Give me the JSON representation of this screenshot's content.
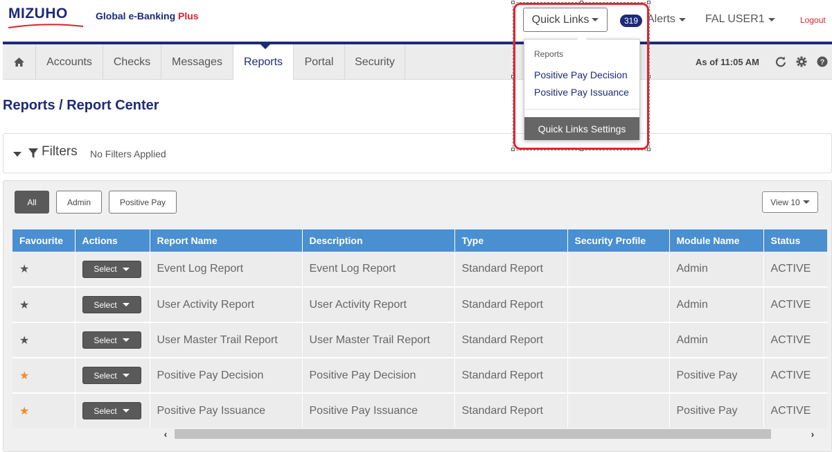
{
  "brand": {
    "logo": "MIZUHO",
    "product_main": "Global e-Banking",
    "product_plus": "Plus"
  },
  "header": {
    "quick_links": "Quick Links",
    "alerts_count": "319",
    "alerts": "Alerts",
    "user": "FAL USER1",
    "logout": "Logout"
  },
  "nav": {
    "items": [
      "Accounts",
      "Checks",
      "Messages",
      "Reports",
      "Portal",
      "Security"
    ],
    "active": "Reports",
    "as_of": "As of 11:05 AM"
  },
  "page": {
    "title": "Reports / Report Center"
  },
  "filters": {
    "title": "Filters",
    "status": "No Filters Applied"
  },
  "toolbar": {
    "chips": [
      "All",
      "Admin",
      "Positive Pay"
    ],
    "active_chip": "All",
    "view": "View 10"
  },
  "table": {
    "columns": [
      "Favourite",
      "Actions",
      "Report Name",
      "Description",
      "Type",
      "Security Profile",
      "Module Name",
      "Status"
    ],
    "rows": [
      {
        "favourite": false,
        "action": "Select",
        "name": "Event Log Report",
        "description": "Event Log Report",
        "type": "Standard Report",
        "security_profile": "",
        "module": "Admin",
        "status": "ACTIVE"
      },
      {
        "favourite": false,
        "action": "Select",
        "name": "User Activity Report",
        "description": "User Activity Report",
        "type": "Standard Report",
        "security_profile": "",
        "module": "Admin",
        "status": "ACTIVE"
      },
      {
        "favourite": false,
        "action": "Select",
        "name": "User Master Trail Report",
        "description": "User Master Trail Report",
        "type": "Standard Report",
        "security_profile": "",
        "module": "Admin",
        "status": "ACTIVE"
      },
      {
        "favourite": true,
        "action": "Select",
        "name": "Positive Pay Decision",
        "description": "Positive Pay Decision",
        "type": "Standard Report",
        "security_profile": "",
        "module": "Positive Pay",
        "status": "ACTIVE"
      },
      {
        "favourite": true,
        "action": "Select",
        "name": "Positive Pay Issuance",
        "description": "Positive Pay Issuance",
        "type": "Standard Report",
        "security_profile": "",
        "module": "Positive Pay",
        "status": "ACTIVE"
      }
    ]
  },
  "quick_links_menu": {
    "section": "Reports",
    "links": [
      "Positive Pay Decision",
      "Positive Pay Issuance"
    ],
    "settings": "Quick Links Settings"
  },
  "colors": {
    "brand_navy": "#1d2a78",
    "brand_red": "#d9232d",
    "table_header": "#4a8fcf",
    "favourite_star": "#f28c28",
    "highlight": "#e4232f"
  },
  "icons": {
    "home": "home-icon",
    "refresh": "refresh-icon",
    "settings": "gear-icon",
    "help": "help-icon",
    "filter": "filter-icon"
  }
}
